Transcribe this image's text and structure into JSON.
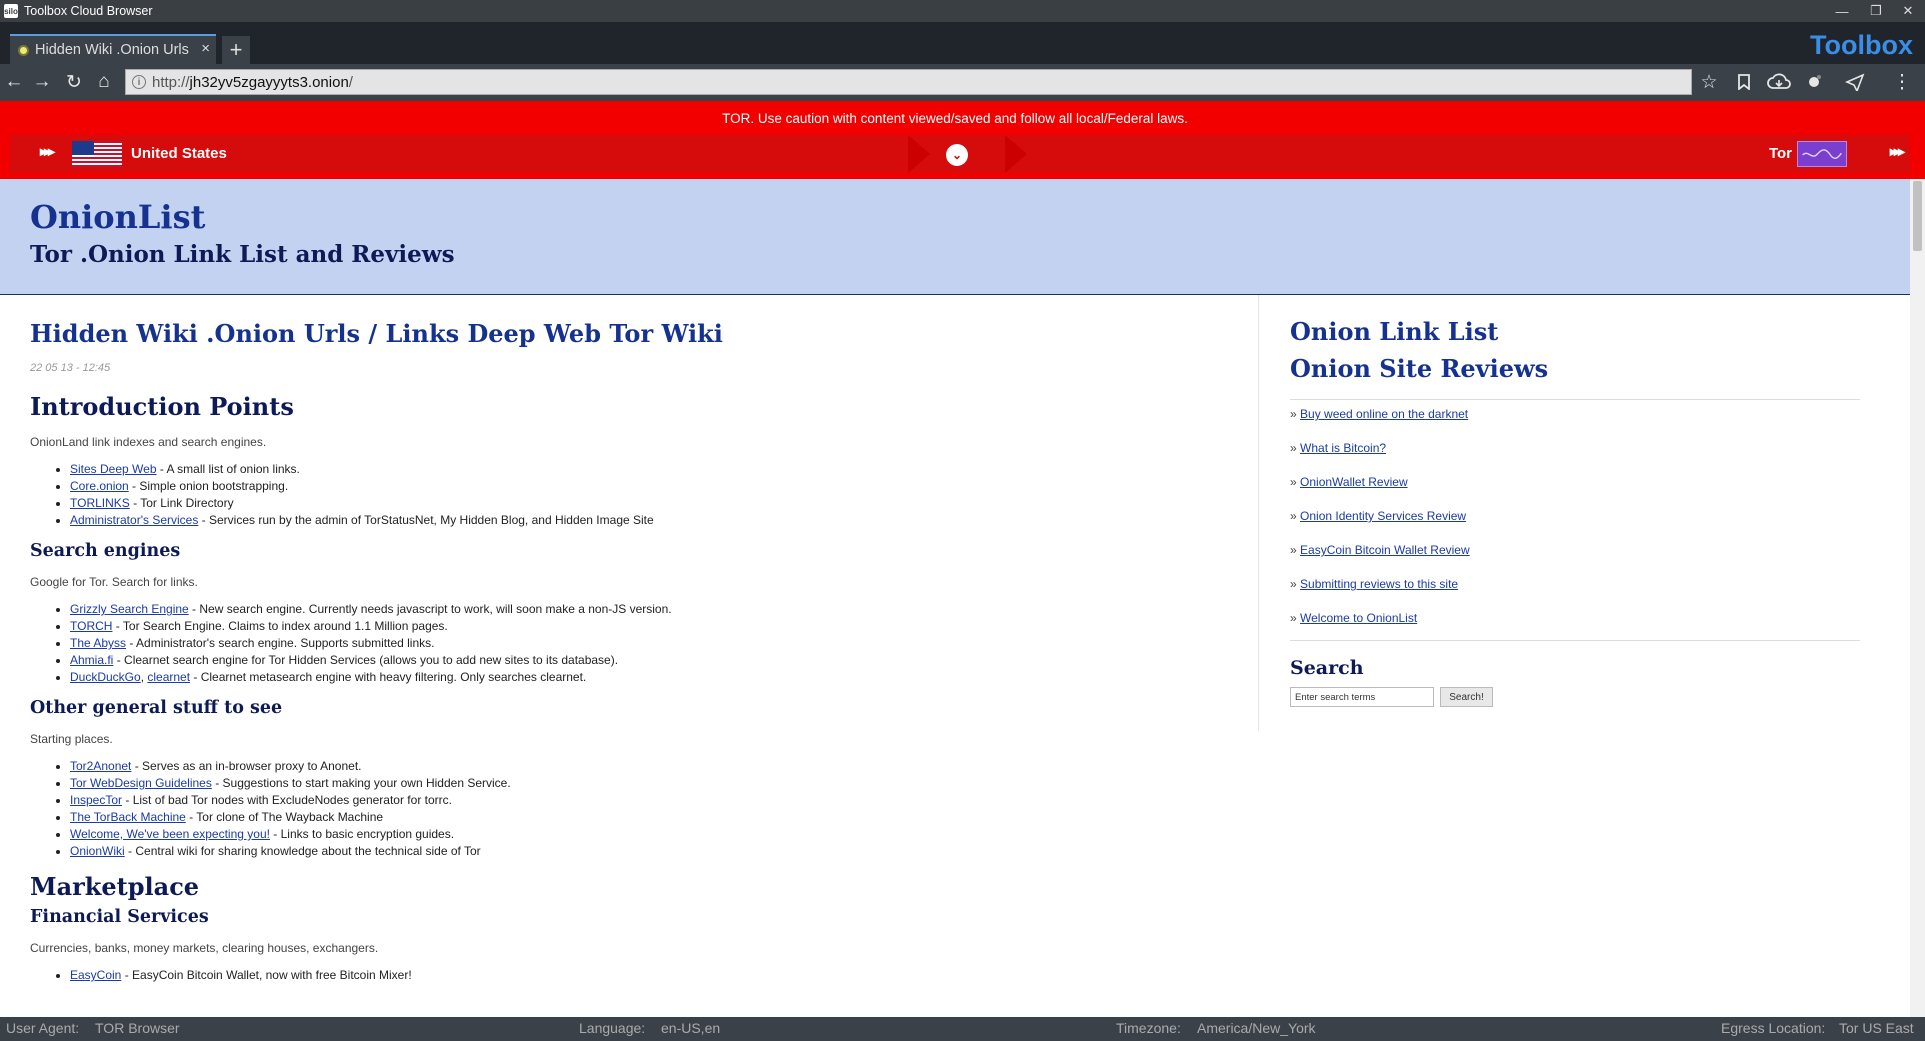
{
  "window": {
    "title": "Toolbox Cloud Browser",
    "app_icon_text": "silo",
    "minimize": "—",
    "restore": "❐",
    "close": "✕"
  },
  "tabs": [
    {
      "label": "Hidden Wiki .Onion Urls",
      "close": "×"
    }
  ],
  "new_tab": "+",
  "brand": "Toolbox",
  "nav": {
    "back": "←",
    "forward": "→",
    "reload": "↻",
    "home": "⌂",
    "url_scheme": "http://",
    "url_host": "jh32yv5zgayyyts3.onion",
    "url_path": "/",
    "star": "☆",
    "bookmark": "🔖",
    "cloud": "☁",
    "extension": "⬤",
    "share": "⇪",
    "menu": "⋮"
  },
  "tor_banner": {
    "caution": "TOR. Use caution with content viewed/saved and follow all local/Federal laws.",
    "arrows": "▸▸▸",
    "country": "United States",
    "dropdown": "⌄",
    "network": "Tor"
  },
  "site": {
    "name": "OnionList",
    "tagline": "Tor .Onion Link List and Reviews"
  },
  "article": {
    "title": "Hidden Wiki .Onion Urls / Links Deep Web Tor Wiki",
    "date": "22 05 13 - 12:45",
    "sections": [
      {
        "heading": "Introduction Points",
        "level": "h2",
        "desc": "OnionLand link indexes and search engines.",
        "items": [
          {
            "links": [
              "Sites Deep Web"
            ],
            "text": " - A small list of onion links."
          },
          {
            "links": [
              "Core.onion"
            ],
            "text": " - Simple onion bootstrapping."
          },
          {
            "links": [
              "TORLINKS"
            ],
            "text": " - Tor Link Directory"
          },
          {
            "links": [
              "Administrator's Services"
            ],
            "text": " - Services run by the admin of TorStatusNet, My Hidden Blog, and Hidden Image Site"
          }
        ]
      },
      {
        "heading": "Search engines",
        "level": "h3",
        "desc": "Google for Tor. Search for links.",
        "items": [
          {
            "links": [
              "Grizzly Search Engine"
            ],
            "text": " - New search engine. Currently needs javascript to work, will soon make a non-JS version."
          },
          {
            "links": [
              "TORCH"
            ],
            "text": " - Tor Search Engine. Claims to index around 1.1 Million pages."
          },
          {
            "links": [
              "The Abyss"
            ],
            "text": " - Administrator's search engine. Supports submitted links."
          },
          {
            "links": [
              "Ahmia.fi"
            ],
            "text": " - Clearnet search engine for Tor Hidden Services (allows you to add new sites to its database)."
          },
          {
            "links": [
              "DuckDuckGo",
              "clearnet"
            ],
            "text": " - Clearnet metasearch engine with heavy filtering. Only searches clearnet."
          }
        ]
      },
      {
        "heading": "Other general stuff to see",
        "level": "h3",
        "desc": "Starting places.",
        "items": [
          {
            "links": [
              "Tor2Anonet"
            ],
            "text": " - Serves as an in-browser proxy to Anonet."
          },
          {
            "links": [
              "Tor WebDesign Guidelines"
            ],
            "text": " - Suggestions to start making your own Hidden Service."
          },
          {
            "links": [
              "InspecTor"
            ],
            "text": " - List of bad Tor nodes with ExcludeNodes generator for torrc."
          },
          {
            "links": [
              "The TorBack Machine"
            ],
            "text": " - Tor clone of The Wayback Machine"
          },
          {
            "links": [
              "Welcome, We've been expecting you!"
            ],
            "text": " - Links to basic encryption guides."
          },
          {
            "links": [
              "OnionWiki"
            ],
            "text": " - Central wiki for sharing knowledge about the technical side of Tor"
          }
        ]
      },
      {
        "heading": "Marketplace",
        "level": "h2",
        "desc": "",
        "items": []
      },
      {
        "heading": "Financial Services",
        "level": "h3",
        "desc": "Currencies, banks, money markets, clearing houses, exchangers.",
        "items": [
          {
            "links": [
              "EasyCoin"
            ],
            "text": " - EasyCoin Bitcoin Wallet, now with free Bitcoin Mixer!"
          }
        ]
      }
    ]
  },
  "sidebar": {
    "title_line1": "Onion Link List",
    "title_line2": "Onion Site Reviews",
    "bullet": "» ",
    "links": [
      "Buy weed online on the darknet",
      "What is Bitcoin?",
      "OnionWallet Review",
      "Onion Identity Services Review",
      "EasyCoin Bitcoin Wallet Review",
      "Submitting reviews to this site",
      "Welcome to OnionList"
    ],
    "search_heading": "Search",
    "search_placeholder": "Enter search terms",
    "search_button": "Search!"
  },
  "status": {
    "user_agent_label": "User Agent:",
    "user_agent": "TOR Browser",
    "language_label": "Language:",
    "language": "en-US,en",
    "timezone_label": "Timezone:",
    "timezone": "America/New_York",
    "egress_label": "Egress Location:",
    "egress": "Tor US East"
  },
  "colors": {
    "banner_red": "#f20000",
    "link_blue": "#1b3ba5",
    "header_bg": "#c4d2f2",
    "brand_blue": "#3a8ee8",
    "tor_purple": "#7b3fcf"
  }
}
